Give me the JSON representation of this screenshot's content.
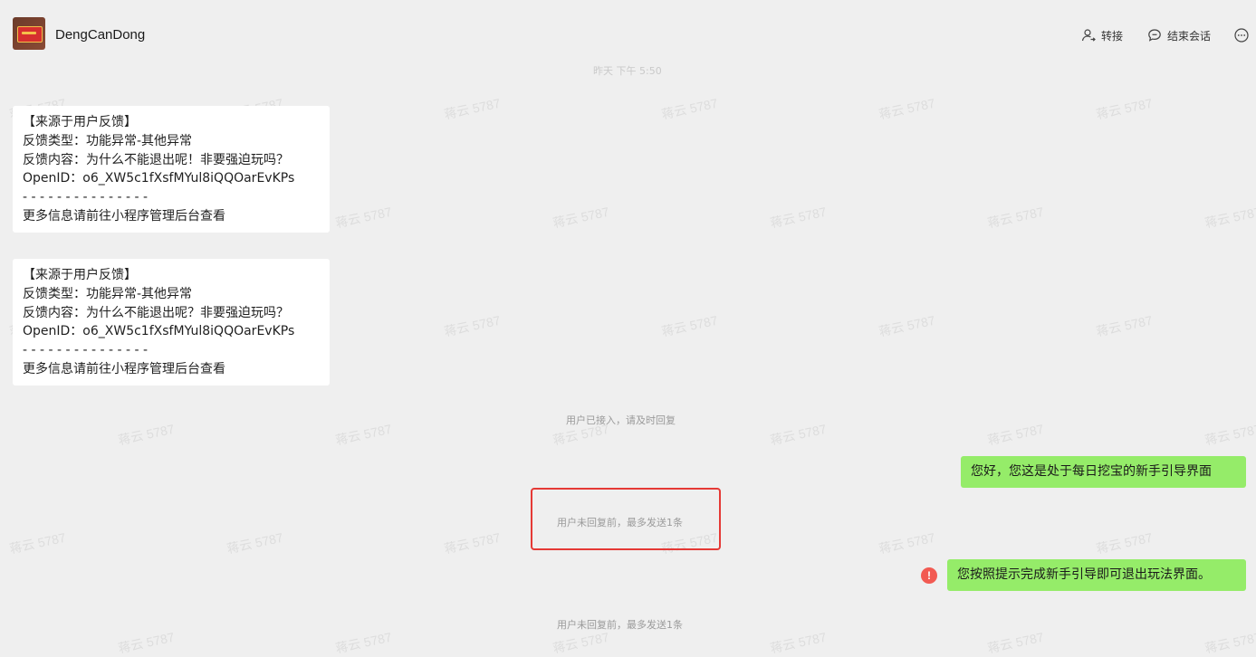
{
  "header": {
    "contact_name": "DengCanDong",
    "transfer_label": "转接",
    "end_session_label": "结束会话"
  },
  "top_time": "昨天 下午 5:50",
  "messages": {
    "card_1": {
      "line_1": "【来源于用户反馈】",
      "line_2": "反馈类型：功能异常-其他异常",
      "line_3": "反馈内容：为什么不能退出呢！非要强迫玩吗？",
      "line_4": "OpenID：o6_XW5c1fXsfMYul8iQQOarEvKPs",
      "line_5": "- - - - - - - - - - - - - - -",
      "line_6": "更多信息请前往小程序管理后台查看"
    },
    "card_2": {
      "line_1": "【来源于用户反馈】",
      "line_2": "反馈类型：功能异常-其他异常",
      "line_3": "反馈内容：为什么不能退出呢？非要强迫玩吗？",
      "line_4": "OpenID：o6_XW5c1fXsfMYul8iQQOarEvKPs",
      "line_5": "- - - - - - - - - - - - - - -",
      "line_6": "更多信息请前往小程序管理后台查看"
    },
    "system_joined": "用户已接入，请及时回复",
    "reply_1": "您好，您这是处于每日挖宝的新手引导界面",
    "system_limit_1": "用户未回复前，最多发送1条",
    "reply_2": "您按照提示完成新手引导即可退出玩法界面。",
    "error_mark": "!",
    "system_limit_2": "用户未回复前，最多发送1条"
  },
  "watermark_text": "蒋云 5787",
  "colors": {
    "background": "#efefef",
    "outgoing_bubble": "#95ec69",
    "incoming_card": "#ffffff",
    "error": "#f25a52",
    "highlight_border": "#e53935"
  },
  "icons": {
    "transfer": "person-transfer-icon",
    "end_session": "chat-bubble-icon",
    "more": "more-dots-icon",
    "error": "exclamation-circle-icon"
  }
}
